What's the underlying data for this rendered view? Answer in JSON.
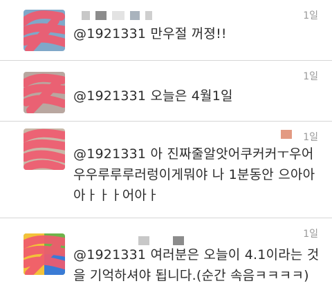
{
  "tweets": [
    {
      "time": "1일",
      "lines": [
        "@1921331 만우절 꺼졍!!"
      ],
      "avatar_colors": {
        "bg": "#7fa8c9",
        "scribble": "#f05a6e"
      }
    },
    {
      "time": "1일",
      "lines": [
        "@1921331 오늘은 4월1일"
      ],
      "avatar_colors": {
        "bg": "#b9a7a0",
        "scribble": "#f05a6e"
      }
    },
    {
      "time": "1일",
      "lines": [
        "@1921331 아 진짜줄알앗어쿠커커ㅜ우어",
        "우우루루루러렁이게뭐야 나 1분동안 으아아",
        "아ㅏㅏㅏ어아ㅏ"
      ],
      "avatar_colors": {
        "bg": "#c9b8a8",
        "scribble": "#f05a6e"
      }
    },
    {
      "time": "1일",
      "lines": [
        "@1921331 여러분은 오늘이 4.1이라는 것",
        "을 기억하셔야 됩니다.(순간 속음ㅋㅋㅋㅋ)"
      ],
      "avatar_colors": {
        "bg": "#6fb34a",
        "scribble": "#f05a6e"
      }
    }
  ]
}
